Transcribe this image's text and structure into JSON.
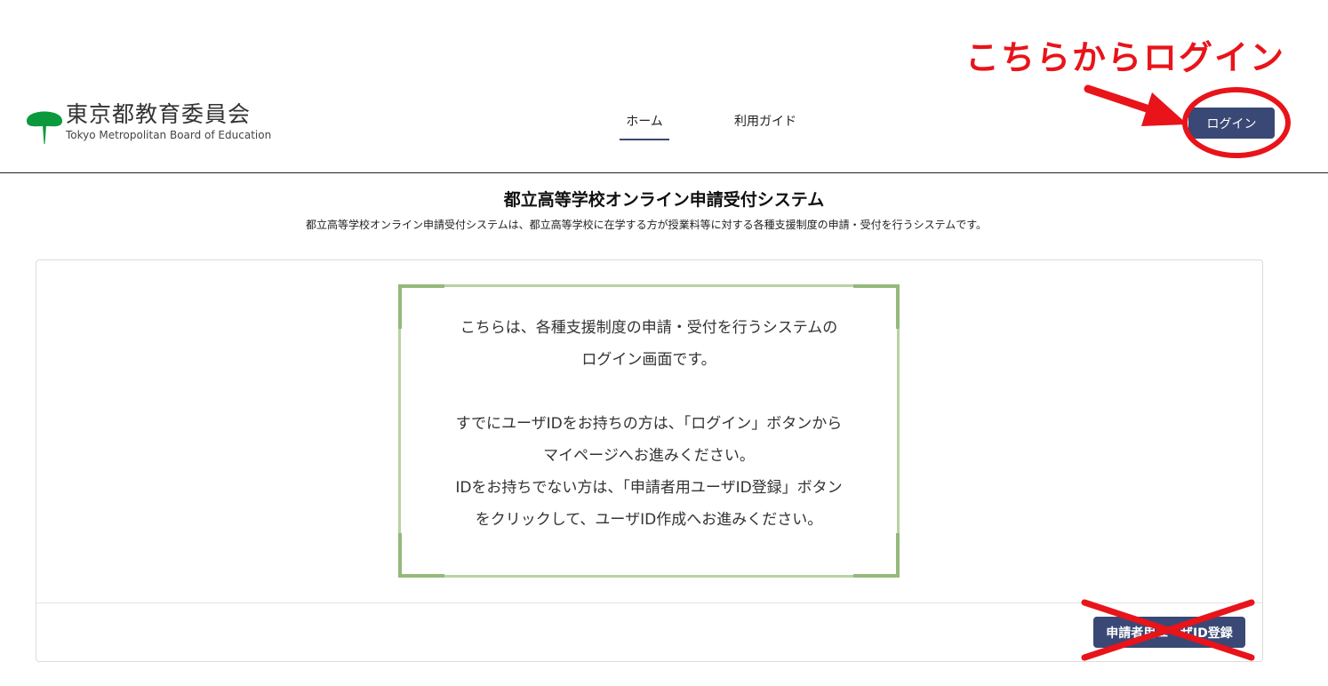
{
  "annotation": {
    "text": "こちらからログイン",
    "color": "#e8141a"
  },
  "header": {
    "logo_ja": "東京都教育委員会",
    "logo_en": "Tokyo Metropolitan Board of Education",
    "nav": [
      {
        "label": "ホーム",
        "active": true
      },
      {
        "label": "利用ガイド",
        "active": false
      }
    ],
    "login_label": "ログイン"
  },
  "main": {
    "title": "都立高等学校オンライン申請受付システム",
    "subtitle": "都立高等学校オンライン申請受付システムは、都立高等学校に在学する方が授業料等に対する各種支援制度の申請・受付を行うシステムです。",
    "notice_lines": [
      "こちらは、各種支援制度の申請・受付を行うシステムの",
      "ログイン画面です。",
      "",
      "すでにユーザIDをお持ちの方は、「ログイン」ボタンから",
      "マイページへお進みください。",
      "IDをお持ちでない方は、「申請者用ユーザID登録」ボタン",
      "をクリックして、ユーザID作成へお進みください。"
    ],
    "register_label": "申請者用ユーザID登録"
  },
  "colors": {
    "brand_navy": "#3a4875",
    "logo_green": "#0a9a3c",
    "notice_border": "#b8d2a4"
  }
}
